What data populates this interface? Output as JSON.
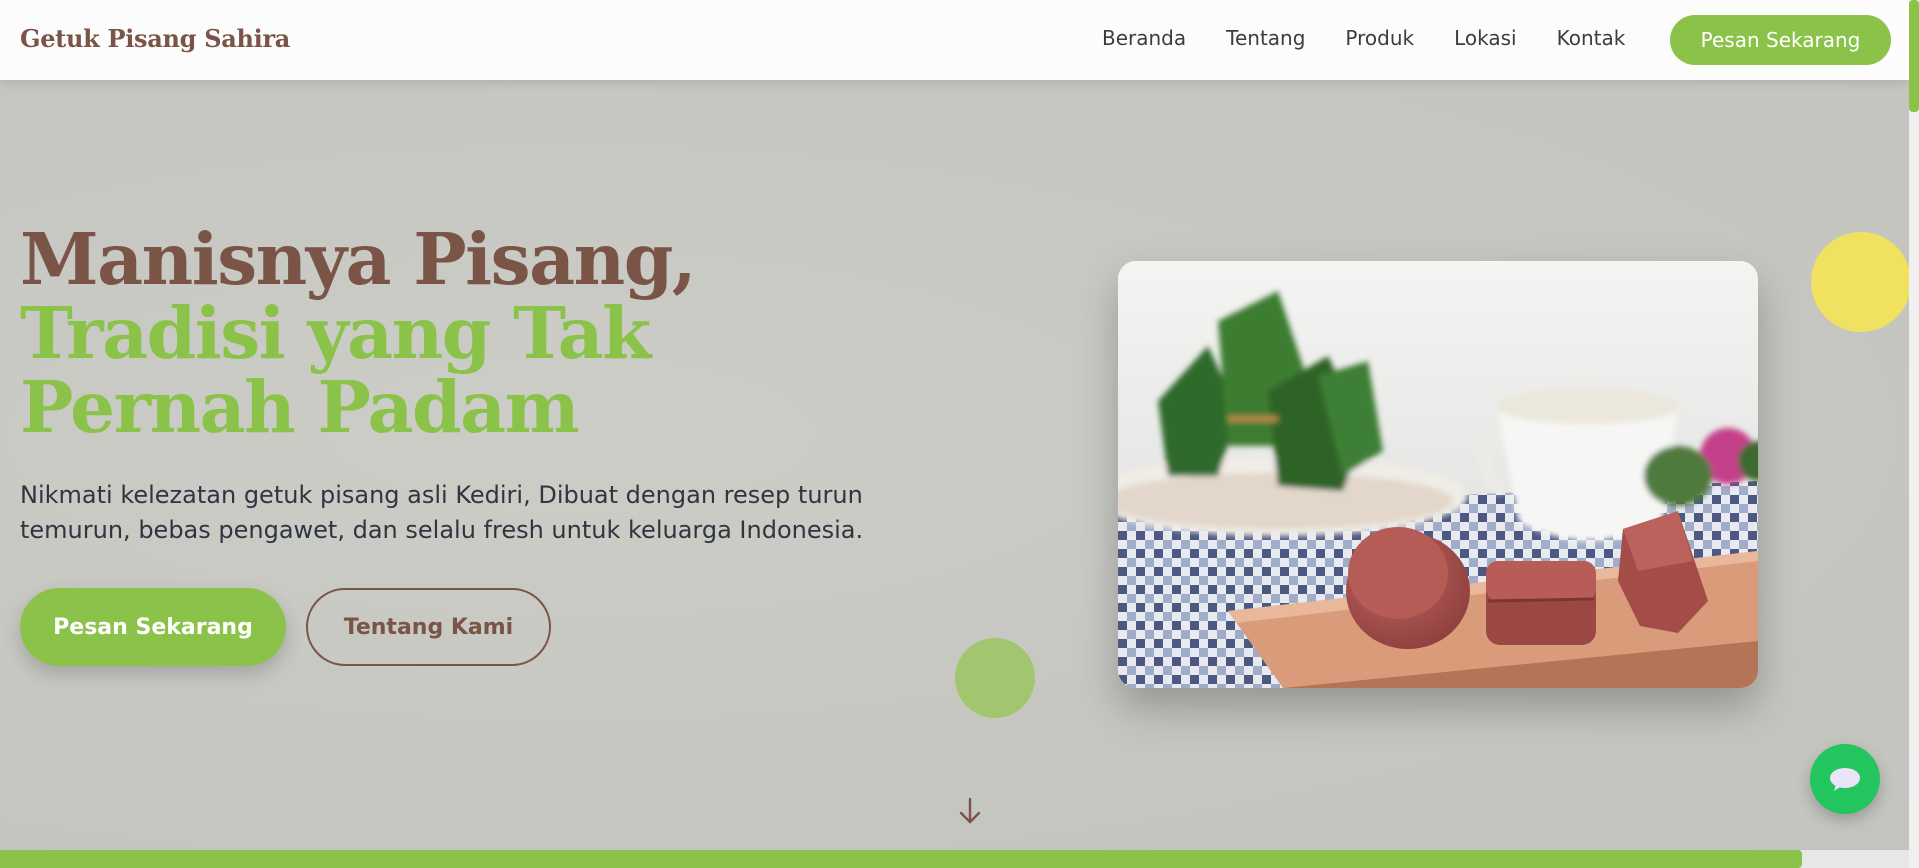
{
  "header": {
    "logo": "Getuk Pisang Sahira",
    "nav": [
      "Beranda",
      "Tentang",
      "Produk",
      "Lokasi",
      "Kontak"
    ],
    "cta_label": "Pesan Sekarang"
  },
  "hero": {
    "title_line1": "Manisnya Pisang,",
    "title_line2": "Tradisi yang Tak Pernah Padam",
    "subtitle": "Nikmati kelezatan getuk pisang asli Kediri, Dibuat dengan resep turun temurun, bebas pengawet, dan selalu fresh untuk keluarga Indonesia.",
    "primary_button": "Pesan Sekarang",
    "secondary_button": "Tentang Kami",
    "image_icon": "getuk-pisang-photo"
  },
  "scroll_indicator_icon": "arrow-down-icon",
  "chat_icon": "chat-bubble-icon",
  "page_progress": 0.944,
  "colors": {
    "brand_brown": "#7a5446",
    "brand_green": "#8bc34a",
    "accent_yellow": "#f0e260",
    "chat_green": "#22c55e"
  }
}
